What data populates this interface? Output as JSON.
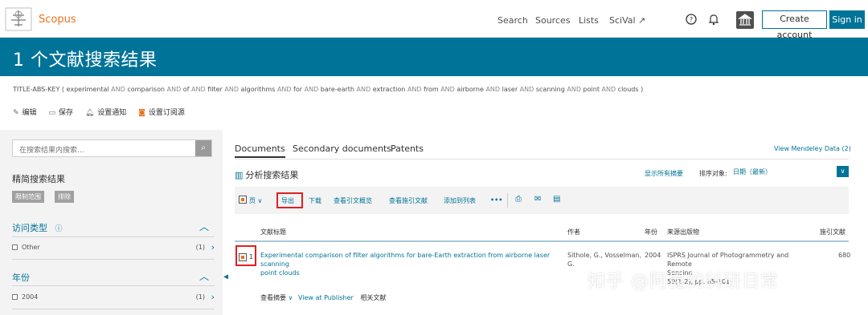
{
  "brand": {
    "name": "Scopus",
    "accent": "#e9711c",
    "primary": "#007398"
  },
  "nav": {
    "search": "Search",
    "sources": "Sources",
    "lists": "Lists",
    "scival": "SciVal ↗",
    "create_account": "Create account",
    "sign_in": "Sign in",
    "help_icon": "help-icon",
    "bell_icon": "bell-icon",
    "institution_icon": "institution-icon"
  },
  "banner": {
    "title": "1 个文献搜索结果"
  },
  "query": {
    "prefix": "TITLE-ABS-KEY (",
    "terms": [
      "experimental",
      "comparison",
      "of",
      "filter",
      "algorithms",
      "for",
      "bare-earth",
      "extraction",
      "from",
      "airborne",
      "laser",
      "scanning",
      "point",
      "clouds"
    ],
    "operator": "AND",
    "suffix": ")"
  },
  "query_actions": {
    "edit": "编辑",
    "save": "保存",
    "alert": "设置通知",
    "feed": "设置订阅源"
  },
  "sidebar": {
    "search_placeholder": "在搜索结果内搜索...",
    "refine_title": "精简搜索结果",
    "limit_to": "限制范围",
    "exclude": "排除",
    "facets": [
      {
        "title": "访问类型",
        "rows": [
          {
            "label": "Other",
            "count": "(1)"
          }
        ]
      },
      {
        "title": "年份",
        "rows": [
          {
            "label": "2004",
            "count": "(1)"
          }
        ]
      }
    ]
  },
  "main": {
    "tabs": [
      "Documents",
      "Secondary documents",
      "Patents"
    ],
    "mendeley": "View Mendeley Data (2)",
    "analyze": "分析搜索结果",
    "show_all_abstracts": "显示所有摘要",
    "sort_label": "排序对象:",
    "sort_value": "日期（最新）",
    "toolbar": {
      "page": "页",
      "export": "导出",
      "download": "下载",
      "citation_overview": "查看引文概览",
      "cited_by": "查看施引文献",
      "add_to_list": "添加到列表",
      "more": "•••"
    },
    "columns": [
      "文献标题",
      "作者",
      "年份",
      "来源出版物",
      "施引文献"
    ],
    "rows": [
      {
        "index": "1",
        "title_line1": "Experimental comparison of filter algorithms for bare-Earth extraction from airborne laser scanning",
        "title_line2": "point clouds",
        "authors_line1": "Sithole, G., Vosselman,",
        "authors_line2": "G.",
        "year": "2004",
        "source_line1": "ISPRS Journal of Photogrammetry and Remote",
        "source_line2": "Sensing",
        "source_line3": "59(1-2), pp. 85-101",
        "cited_by": "680"
      }
    ],
    "row_actions": {
      "view_abstract": "查看摘要",
      "view_publisher": "View at Publisher",
      "related": "相关文献"
    }
  },
  "watermark": "知乎 @阿昆的科研日常"
}
